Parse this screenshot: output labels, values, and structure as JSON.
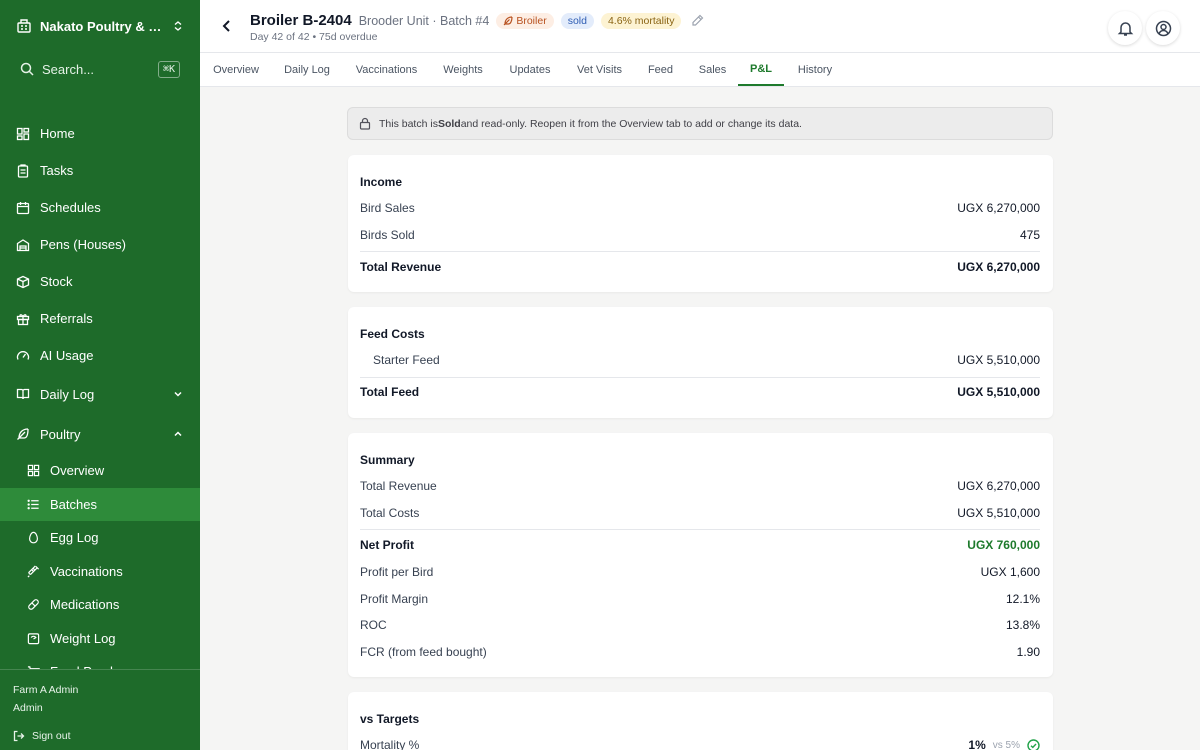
{
  "sidebar": {
    "org_name": "Nakato Poultry & Dairy",
    "search": {
      "placeholder": "Search...",
      "shortcut": "⌘K"
    },
    "items": [
      {
        "label": "Home",
        "icon": "home-grid-icon"
      },
      {
        "label": "Tasks",
        "icon": "clipboard-icon"
      },
      {
        "label": "Schedules",
        "icon": "calendar-icon"
      },
      {
        "label": "Pens (Houses)",
        "icon": "warehouse-icon"
      },
      {
        "label": "Stock",
        "icon": "box-icon"
      },
      {
        "label": "Referrals",
        "icon": "gift-icon"
      },
      {
        "label": "AI Usage",
        "icon": "gauge-icon"
      }
    ],
    "groups": {
      "daily_log": {
        "label": "Daily Log",
        "expanded": false
      },
      "poultry": {
        "label": "Poultry",
        "expanded": true
      }
    },
    "poultry_items": [
      {
        "label": "Overview",
        "icon": "grid-icon"
      },
      {
        "label": "Batches",
        "icon": "list-icon",
        "active": true
      },
      {
        "label": "Egg Log",
        "icon": "egg-icon"
      },
      {
        "label": "Vaccinations",
        "icon": "syringe-icon"
      },
      {
        "label": "Medications",
        "icon": "pill-icon"
      },
      {
        "label": "Weight Log",
        "icon": "scale-icon"
      },
      {
        "label": "Feed Purchases",
        "icon": "cart-icon"
      }
    ],
    "footer": {
      "user_name": "Farm A Admin",
      "role": "Admin",
      "signout_label": "Sign out"
    }
  },
  "header": {
    "title": "Broiler B-2404",
    "subtitle": "Brooder Unit · Batch #4",
    "badges": {
      "breed": "Broiler",
      "status": "sold",
      "mortality": "4.6% mortality"
    },
    "dayline": "Day 42 of 42 • 75d overdue"
  },
  "tabs": [
    "Overview",
    "Daily Log",
    "Vaccinations",
    "Weights",
    "Updates",
    "Vet Visits",
    "Feed",
    "Sales",
    "P&L",
    "History"
  ],
  "active_tab": "P&L",
  "notice": {
    "pre": "This batch is ",
    "bold": "Sold",
    "post": " and read-only. Reopen it from the Overview tab to add or change its data."
  },
  "income": {
    "title": "Income",
    "rows": [
      {
        "label": "Bird Sales",
        "value": "UGX 6,270,000"
      },
      {
        "label": "Birds Sold",
        "value": "475"
      }
    ],
    "total": {
      "label": "Total Revenue",
      "value": "UGX 6,270,000"
    }
  },
  "feed_costs": {
    "title": "Feed Costs",
    "rows": [
      {
        "label": "Starter Feed",
        "value": "UGX 5,510,000"
      }
    ],
    "total": {
      "label": "Total Feed",
      "value": "UGX 5,510,000"
    }
  },
  "summary": {
    "title": "Summary",
    "revenue": {
      "label": "Total Revenue",
      "value": "UGX 6,270,000"
    },
    "costs": {
      "label": "Total Costs",
      "value": "UGX 5,510,000"
    },
    "net_profit": {
      "label": "Net Profit",
      "value": "UGX 760,000"
    },
    "metrics": [
      {
        "label": "Profit per Bird",
        "value": "UGX 1,600"
      },
      {
        "label": "Profit Margin",
        "value": "12.1%"
      },
      {
        "label": "ROC",
        "value": "13.8%"
      },
      {
        "label": "FCR (from feed bought)",
        "value": "1.90"
      }
    ]
  },
  "targets": {
    "title": "vs Targets",
    "rows": [
      {
        "label": "Mortality %",
        "value": "1%",
        "target": "vs 5%",
        "met": true
      }
    ]
  },
  "colors": {
    "sidebar": "#1e6b2a",
    "sidebar_active": "#2e8b3a",
    "accent": "#1e7a2c",
    "profit": "#1e7a2c"
  }
}
